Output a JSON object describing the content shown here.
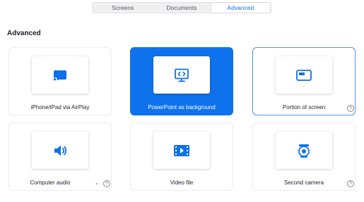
{
  "tabs": [
    {
      "label": "Screens",
      "active": false
    },
    {
      "label": "Documents",
      "active": false
    },
    {
      "label": "Advanced",
      "active": true
    }
  ],
  "section": {
    "title": "Advanced"
  },
  "options": [
    {
      "label": "iPhone/iPad via AirPlay",
      "icon": "airplay-cast-icon",
      "state": "normal"
    },
    {
      "label": "PowerPoint as background",
      "icon": "powerpoint-presenter-icon",
      "state": "selected"
    },
    {
      "label": "Portion of screen",
      "icon": "screen-portion-icon",
      "state": "hovered",
      "help": "?"
    },
    {
      "label": "Computer audio",
      "icon": "speaker-icon",
      "state": "normal",
      "help": "?",
      "has_dropdown": true
    },
    {
      "label": "Video file",
      "icon": "video-file-icon",
      "state": "normal"
    },
    {
      "label": "Second camera",
      "icon": "camera-icon",
      "state": "normal",
      "help": "?"
    }
  ],
  "colors": {
    "accent": "#0e72ed",
    "icon": "#0e71eb"
  }
}
